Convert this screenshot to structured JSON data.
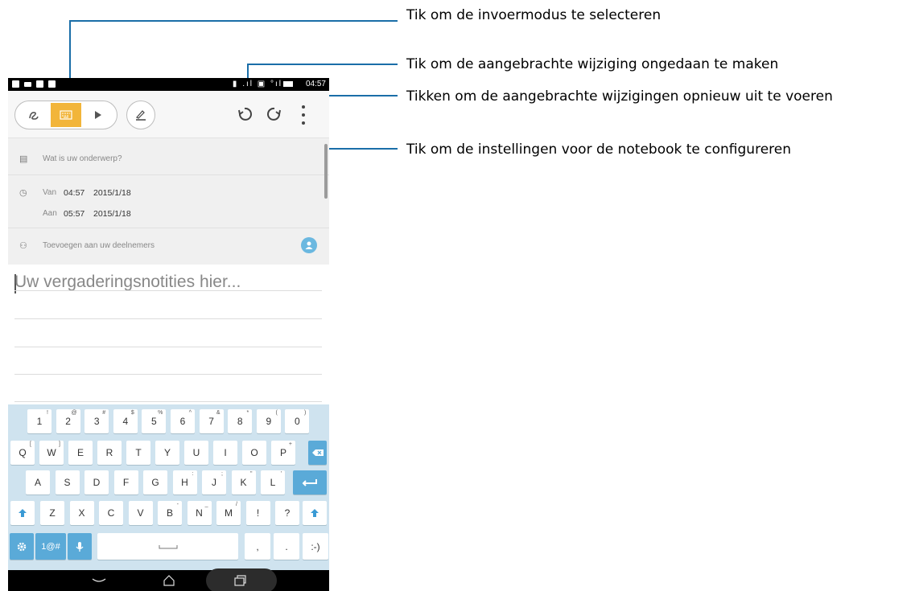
{
  "status_bar": {
    "time": "04:57",
    "signal_text": "▮ .ıl ▣ °ıl"
  },
  "toolbar": {
    "mode_handwriting_icon": "handwriting-icon",
    "mode_keyboard_icon": "keyboard-icon",
    "mode_pen_icon": "pen-icon",
    "pen_style_icon": "pen-style-icon",
    "undo_icon": "undo-icon",
    "redo_icon": "redo-icon",
    "menu_icon": "overflow-menu-icon",
    "accent_color": "#f2b53a"
  },
  "meeting": {
    "subject_placeholder": "Wat is uw onderwerp?",
    "from_label": "Van",
    "from_time": "04:57",
    "from_date": "2015/1/18",
    "to_label": "Aan",
    "to_time": "05:57",
    "to_date": "2015/1/18",
    "participants_placeholder": "Toevoegen aan uw deelnemers"
  },
  "notes": {
    "placeholder": "Uw vergaderingsnotities hier..."
  },
  "keyboard": {
    "row1": [
      {
        "k": "1",
        "s": "!"
      },
      {
        "k": "2",
        "s": "@"
      },
      {
        "k": "3",
        "s": "#"
      },
      {
        "k": "4",
        "s": "$"
      },
      {
        "k": "5",
        "s": "%"
      },
      {
        "k": "6",
        "s": "^"
      },
      {
        "k": "7",
        "s": "&"
      },
      {
        "k": "8",
        "s": "*"
      },
      {
        "k": "9",
        "s": "("
      },
      {
        "k": "0",
        "s": ")"
      }
    ],
    "row2": [
      {
        "k": "Q",
        "s": "["
      },
      {
        "k": "W",
        "s": "]"
      },
      {
        "k": "E",
        "s": ""
      },
      {
        "k": "R",
        "s": ""
      },
      {
        "k": "T",
        "s": ""
      },
      {
        "k": "Y",
        "s": ""
      },
      {
        "k": "U",
        "s": ""
      },
      {
        "k": "I",
        "s": ""
      },
      {
        "k": "O",
        "s": ""
      },
      {
        "k": "P",
        "s": "+"
      }
    ],
    "row3": [
      {
        "k": "A",
        "s": ""
      },
      {
        "k": "S",
        "s": ""
      },
      {
        "k": "D",
        "s": ""
      },
      {
        "k": "F",
        "s": ""
      },
      {
        "k": "G",
        "s": ""
      },
      {
        "k": "H",
        "s": ":"
      },
      {
        "k": "J",
        "s": ";"
      },
      {
        "k": "K",
        "s": "\""
      },
      {
        "k": "L",
        "s": "'"
      }
    ],
    "row4": [
      {
        "k": "Z",
        "s": ""
      },
      {
        "k": "X",
        "s": ""
      },
      {
        "k": "C",
        "s": ""
      },
      {
        "k": "V",
        "s": ""
      },
      {
        "k": "B",
        "s": "-"
      },
      {
        "k": "N",
        "s": "_"
      },
      {
        "k": "M",
        "s": "/"
      },
      {
        "k": "!",
        "s": ""
      },
      {
        "k": "?",
        "s": ""
      }
    ],
    "symbols_label": "1@#",
    "comma_label": ",",
    "period_label": ".",
    "smiley_label": ":-)",
    "key_color": "#5aaad8"
  },
  "callouts": {
    "input_mode": "Tik om de invoermodus te selecteren",
    "undo": "Tik om de aangebrachte wijziging ongedaan te maken",
    "redo": "Tikken om de aangebrachte wijzigingen opnieuw uit te voeren",
    "settings": "Tik om de instellingen voor de notebook te configureren",
    "line_color": "#1a6ea8"
  }
}
